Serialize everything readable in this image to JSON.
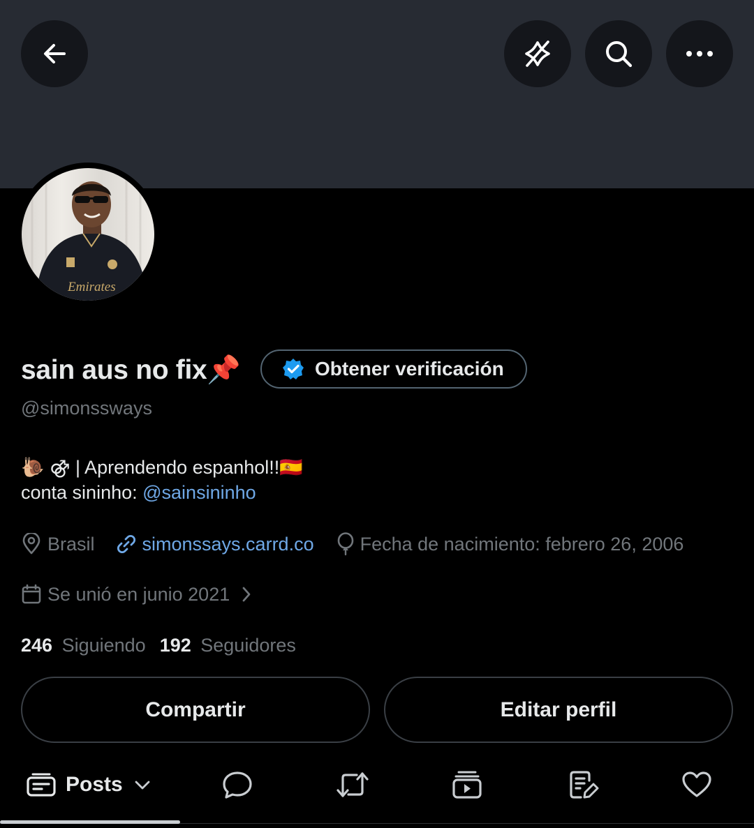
{
  "header": {
    "back_icon": "arrow-left-icon",
    "actions": [
      "no-sound-icon",
      "search-icon",
      "more-icon"
    ]
  },
  "profile": {
    "display_name": "sain aus no fix📌",
    "verify_label": "Obtener verificación",
    "handle": "@simonssways",
    "bio_line1": "🐌 ⚣ | Aprendendo espanhol!!🇪🇸",
    "bio_line2_prefix": "conta sininho: ",
    "bio_line2_link": "@sainsininho",
    "location": "Brasil",
    "website": "simonssays.carrd.co",
    "birthday": "Fecha de nacimiento: febrero 26, 2006",
    "joined": "Se unió en junio 2021"
  },
  "stats": {
    "following_count": "246",
    "following_label": "Siguiendo",
    "followers_count": "192",
    "followers_label": "Seguidores"
  },
  "buttons": {
    "share": "Compartir",
    "edit": "Editar perfil"
  },
  "tabs": {
    "posts_label": "Posts"
  },
  "colors": {
    "background": "#000000",
    "banner": "#272b33",
    "verified_blue": "#1d9bf0",
    "link_blue": "#6fa8e6",
    "muted_text": "#71767b"
  }
}
